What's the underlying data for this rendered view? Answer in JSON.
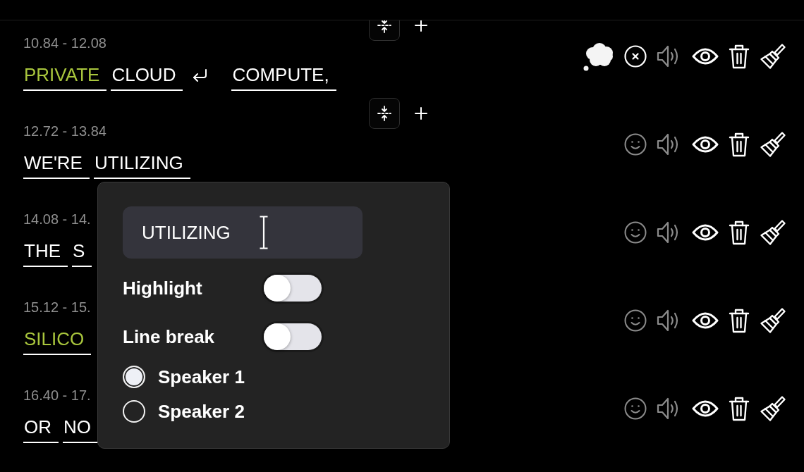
{
  "segments": [
    {
      "time": "10.84 - 12.08",
      "merge_controls": true,
      "emotion_set": true,
      "words": [
        {
          "text": "PRIVATE",
          "highlighted": true,
          "line_break": false
        },
        {
          "text": "CLOUD",
          "highlighted": false,
          "line_break": true
        },
        {
          "text": "COMPUTE,",
          "highlighted": false,
          "line_break": false
        }
      ]
    },
    {
      "time": "12.72 - 13.84",
      "merge_controls": true,
      "emotion_set": false,
      "words": [
        {
          "text": "WE'RE",
          "highlighted": false,
          "line_break": false
        },
        {
          "text": "UTILIZING",
          "highlighted": false,
          "line_break": false
        }
      ]
    },
    {
      "time": "14.08 - 14.",
      "merge_controls": false,
      "emotion_set": false,
      "words": [
        {
          "text": "THE",
          "highlighted": false,
          "line_break": false
        },
        {
          "text": "S",
          "highlighted": false,
          "line_break": false
        }
      ]
    },
    {
      "time": "15.12 - 15.",
      "merge_controls": false,
      "emotion_set": false,
      "words": [
        {
          "text": "SILICO",
          "highlighted": true,
          "line_break": false
        }
      ]
    },
    {
      "time": "16.40 - 17.",
      "merge_controls": false,
      "emotion_set": false,
      "words": [
        {
          "text": "OR",
          "highlighted": false,
          "line_break": false
        },
        {
          "text": "NO",
          "highlighted": false,
          "line_break": false
        }
      ]
    }
  ],
  "word_popup": {
    "value": "UTILIZING",
    "toggles": [
      {
        "label": "Highlight",
        "on": false
      },
      {
        "label": "Line break",
        "on": false
      }
    ],
    "speakers": [
      {
        "label": "Speaker 1",
        "selected": true
      },
      {
        "label": "Speaker 2",
        "selected": false
      }
    ]
  }
}
